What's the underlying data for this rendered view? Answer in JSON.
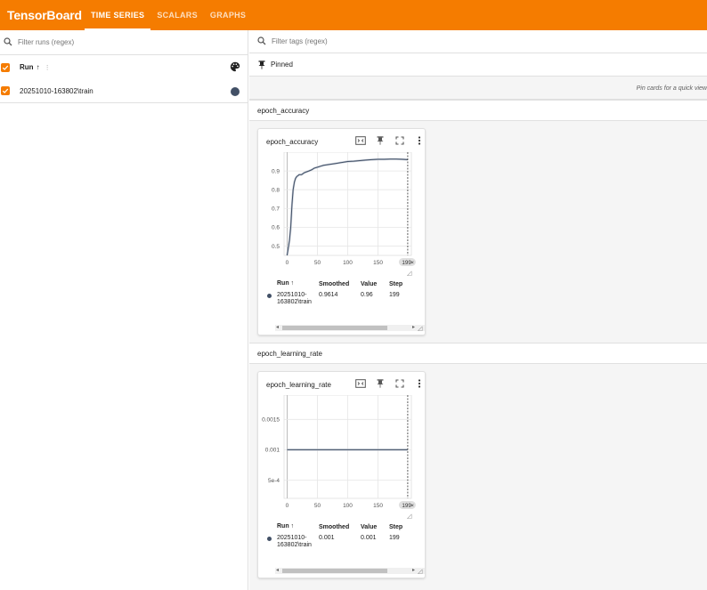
{
  "app": {
    "brand": "TensorBoard",
    "tabs": [
      {
        "label": "TIME SERIES",
        "active": true
      },
      {
        "label": "SCALARS",
        "active": false
      },
      {
        "label": "GRAPHS",
        "active": false
      }
    ],
    "accent": "#f57c00"
  },
  "runs_pane": {
    "filter_placeholder": "Filter runs (regex)",
    "header_label": "Run",
    "sort_glyph": "↑",
    "more_glyph": "⋮",
    "palette_icon": "palette-icon",
    "runs": [
      {
        "name": "20251010-163802\\train",
        "color": "#425066",
        "checked": true
      }
    ]
  },
  "main": {
    "tag_filter_placeholder": "Filter tags (regex)",
    "pinned_label": "Pinned",
    "pinned_hint": "Pin cards for a quick view",
    "groups": [
      {
        "name": "epoch_accuracy",
        "card": {
          "title": "epoch_accuracy",
          "legend_headers": {
            "run": "Run ↑",
            "smoothed": "Smoothed",
            "value": "Value",
            "step": "Step"
          },
          "legend_row": {
            "run": "20251010-163802\\train",
            "smoothed": "0.9614",
            "value": "0.96",
            "step": "199"
          }
        }
      },
      {
        "name": "epoch_learning_rate",
        "card": {
          "title": "epoch_learning_rate",
          "legend_headers": {
            "run": "Run ↑",
            "smoothed": "Smoothed",
            "value": "Value",
            "step": "Step"
          },
          "legend_row": {
            "run": "20251010-163802\\train",
            "smoothed": "0.001",
            "value": "0.001",
            "step": "199"
          }
        }
      }
    ]
  },
  "chart_data": [
    {
      "type": "line",
      "title": "epoch_accuracy",
      "xlim": [
        -5,
        205
      ],
      "ylim": [
        0.45,
        1.0
      ],
      "x_ticks": [
        0,
        50,
        100,
        150
      ],
      "x_tick_labels": [
        "0",
        "50",
        "100",
        "150"
      ],
      "y_ticks": [
        0.5,
        0.6,
        0.7,
        0.8,
        0.9
      ],
      "y_tick_labels": [
        "0.5",
        "0.6",
        "0.7",
        "0.8",
        "0.9"
      ],
      "step_marker": {
        "x": 199,
        "label": "199"
      },
      "series": [
        {
          "color": "#425066",
          "x": [
            0,
            2,
            4,
            6,
            8,
            10,
            12,
            14,
            16,
            18,
            20,
            24,
            28,
            32,
            36,
            40,
            45,
            50,
            55,
            60,
            70,
            80,
            90,
            100,
            110,
            120,
            130,
            140,
            150,
            160,
            170,
            180,
            190,
            199
          ],
          "y": [
            0.45,
            0.49,
            0.53,
            0.6,
            0.72,
            0.8,
            0.84,
            0.86,
            0.87,
            0.875,
            0.88,
            0.88,
            0.89,
            0.895,
            0.9,
            0.905,
            0.915,
            0.92,
            0.925,
            0.93,
            0.935,
            0.94,
            0.945,
            0.95,
            0.952,
            0.955,
            0.958,
            0.96,
            0.962,
            0.962,
            0.963,
            0.963,
            0.962,
            0.96
          ]
        }
      ]
    },
    {
      "type": "line",
      "title": "epoch_learning_rate",
      "xlim": [
        -5,
        205
      ],
      "ylim": [
        0.0002,
        0.0019
      ],
      "x_ticks": [
        0,
        50,
        100,
        150
      ],
      "x_tick_labels": [
        "0",
        "50",
        "100",
        "150"
      ],
      "y_ticks": [
        0.0005,
        0.001,
        0.0015
      ],
      "y_tick_labels": [
        "5e-4",
        "0.001",
        "0.0015"
      ],
      "step_marker": {
        "x": 199,
        "label": "199"
      },
      "series": [
        {
          "color": "#425066",
          "x": [
            0,
            199
          ],
          "y": [
            0.001,
            0.001
          ]
        }
      ]
    }
  ]
}
